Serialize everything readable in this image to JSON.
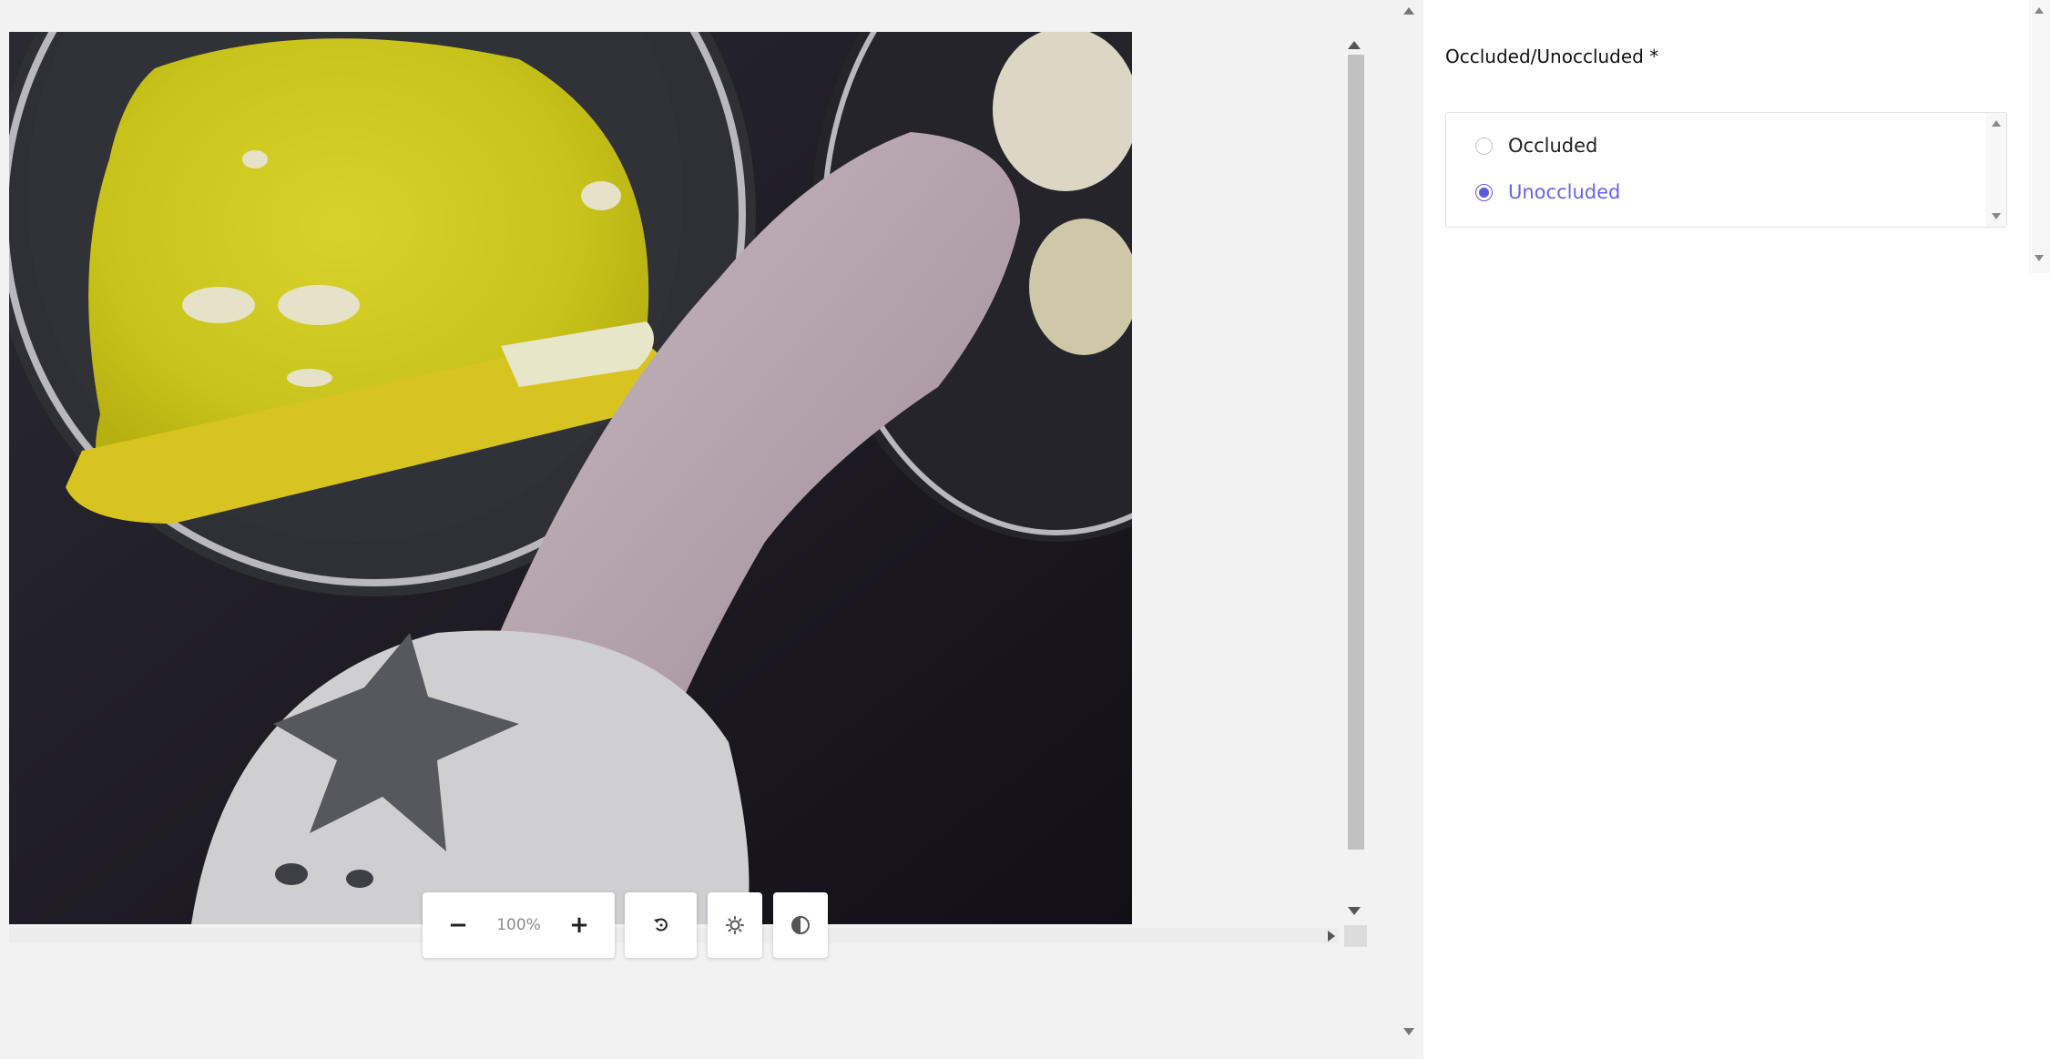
{
  "canvas": {
    "image_description_icon": "photo-frame",
    "zoom": {
      "zoom_out_symbol": "−",
      "zoom_level": "100%",
      "zoom_in_symbol": "+"
    },
    "tools": {
      "rotate_icon": "rotate-icon",
      "brightness_icon": "brightness-icon",
      "contrast_icon": "contrast-icon"
    }
  },
  "panel": {
    "question_title": "Occluded/Unoccluded *",
    "options": [
      {
        "label": "Occluded",
        "selected": false
      },
      {
        "label": "Unoccluded",
        "selected": true
      }
    ]
  },
  "colors": {
    "accent": "#5b5bd6",
    "selected_text": "#6b62e0",
    "background": "#f2f2f2",
    "panel_background": "#ffffff"
  }
}
